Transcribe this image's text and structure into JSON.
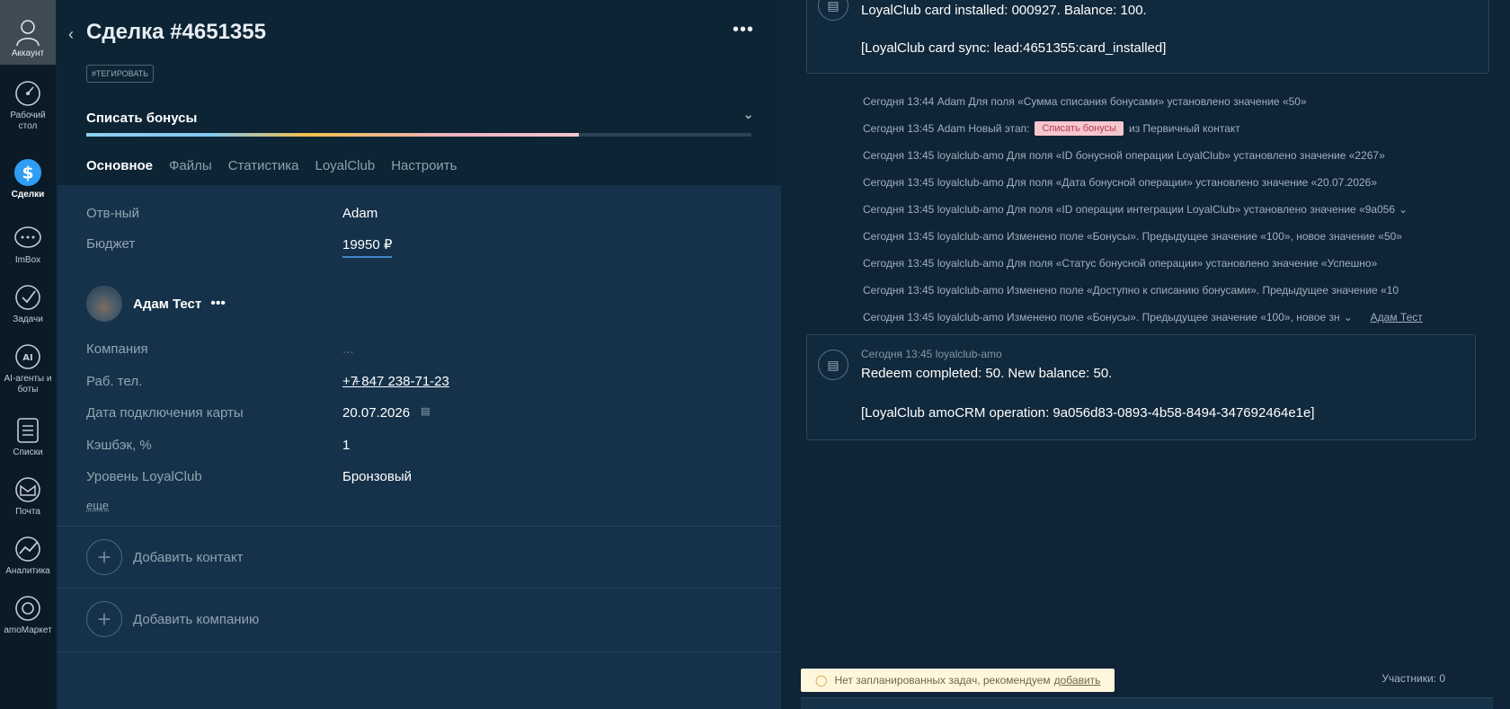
{
  "nav": {
    "account": "Аккаунт",
    "items": [
      {
        "label": "Рабочий стол",
        "icon": "dashboard-icon"
      },
      {
        "label": "Сделки",
        "icon": "deals-icon"
      },
      {
        "label": "ImBox",
        "icon": "chat-icon"
      },
      {
        "label": "Задачи",
        "icon": "tasks-icon"
      },
      {
        "label": "AI-агенты и боты",
        "icon": "ai-icon"
      },
      {
        "label": "Списки",
        "icon": "lists-icon"
      },
      {
        "label": "Почта",
        "icon": "mail-icon"
      },
      {
        "label": "Аналитика",
        "icon": "analytics-icon"
      },
      {
        "label": "amoМаркет",
        "icon": "market-icon"
      }
    ]
  },
  "deal": {
    "title": "Сделка #4651355",
    "tag_button": "#ТЕГИРОВАТЬ",
    "pipeline_stage": "Списать бонусы",
    "progress": 0.74,
    "tabs": [
      "Основное",
      "Файлы",
      "Статистика",
      "LoyalClub",
      "Настроить"
    ],
    "responsible_label": "Отв-ный",
    "responsible_value": "Adam",
    "budget_label": "Бюджет",
    "budget_value": "19950 ₽",
    "contact_name": "Адам Тест",
    "company_label": "Компания",
    "company_value": "...",
    "phone_label": "Раб. тел.",
    "phone_value": "+7 847 238-71-23",
    "card_date_label": "Дата подключения карты",
    "card_date_value": "20.07.2026",
    "cashback_label": "Кэшбэк, %",
    "cashback_value": "1",
    "level_label": "Уровень LoyalClub",
    "level_value": "Бронзовый",
    "more_link": "еще",
    "add_contact": "Добавить контакт",
    "add_company": "Добавить компанию"
  },
  "feed": {
    "note1_line1": "LoyalClub card installed: 000927. Balance: 100.",
    "note1_line2": "[LoyalClub card sync: lead:4651355:card_installed]",
    "log": [
      "Сегодня 13:44 Adam Для поля «Сумма списания бонусами» установлено значение «50»",
      "Сегодня 13:45 loyalclub-amo Для поля «ID бонусной операции LoyalClub» установлено значение «2267»",
      "Сегодня 13:45 loyalclub-amo Для поля «Дата бонусной операции» установлено значение «20.07.2026»",
      "Сегодня 13:45 loyalclub-amo Для поля «ID операции интеграции LoyalClub» установлено значение «9a056",
      "Сегодня 13:45 loyalclub-amo Изменено поле «Бонусы». Предыдущее значение «100», новое значение «50»",
      "Сегодня 13:45 loyalclub-amo Для поля «Статус бонусной операции» установлено значение «Успешно»",
      "Сегодня 13:45 loyalclub-amo Изменено поле «Доступно к списанию бонусами». Предыдущее значение «10",
      "Сегодня 13:45 loyalclub-amo Изменено поле «Бонусы». Предыдущее значение «100», новое зн"
    ],
    "stage_line_prefix": "Сегодня 13:45 Adam Новый этап:",
    "stage_badge": "Списать бонусы",
    "stage_line_suffix": "из Первичный контакт",
    "log_user_link": "Адам Тест",
    "note2_meta": "Сегодня 13:45 loyalclub-amo",
    "note2_line1": "Redeem completed: 50. New balance: 50.",
    "note2_line2": "[LoyalClub amoCRM operation: 9a056d83-0893-4b58-8494-347692464e1e]",
    "tasks_text": "Нет запланированных задач, рекомендуем",
    "tasks_link": "добавить",
    "participants": "Участники: 0"
  },
  "colors": {
    "nav_bg": "#0a1a26",
    "panel_bg": "#15324a",
    "header_bg": "#0d2434",
    "feed_bg": "#0f2436",
    "stage_badge_bg": "#f6c6cf",
    "budget_underline": "#3f86c6"
  }
}
